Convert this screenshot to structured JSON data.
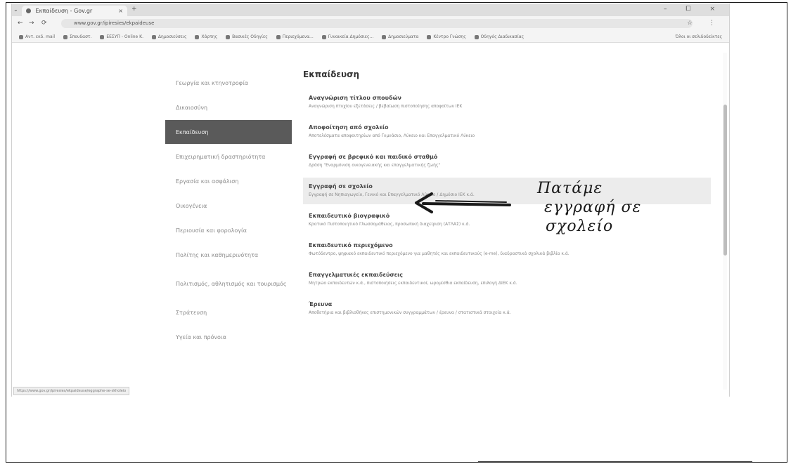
{
  "browser": {
    "tab_title": "Εκπαίδευση - Gov.gr",
    "tab_close": "×",
    "new_tab": "+",
    "window_controls": "– ⧠ ×",
    "tab_menu": "⌄",
    "back": "←",
    "forward": "→",
    "reload": "⟳",
    "address": "www.gov.gr/ipiresies/ekpaideuse",
    "toolbar_right": "☆ ⋮",
    "bookmarks": [
      "Αντ. εκδ. mail",
      "Σπουδαστ.",
      "ΕΕΣΥΠ - Online Κ.",
      "Δημοσιεύσεις",
      "Χάρτης",
      "Βασικές Οδηγίες",
      "Περιεχόμενα...",
      "Γυναικεία Δημόσιες...",
      "Δημοσιεύματα",
      "Κέντρο Γνώσης",
      "Οδηγός Διαδικασίας"
    ],
    "bookmarks_right": "Όλοι οι σελιδοδείκτες",
    "status_url": "https://www.gov.gr/ipiresies/ekpaideuse/eggraphe-se-skholeio"
  },
  "sidebar": {
    "items": [
      {
        "label": "Γεωργία και κτηνοτροφία"
      },
      {
        "label": "Δικαιοσύνη"
      },
      {
        "label": "Εκπαίδευση"
      },
      {
        "label": "Επιχειρηματική δραστηριότητα"
      },
      {
        "label": "Εργασία και ασφάλιση"
      },
      {
        "label": "Οικογένεια"
      },
      {
        "label": "Περιουσία και φορολογία"
      },
      {
        "label": "Πολίτης και καθημερινότητα"
      },
      {
        "label": "Πολιτισμός, αθλητισμός και τουρισμός"
      },
      {
        "label": "Στράτευση"
      },
      {
        "label": "Υγεία και πρόνοια"
      }
    ]
  },
  "main": {
    "title": "Εκπαίδευση",
    "entries": [
      {
        "title": "Αναγνώριση τίτλου σπουδών",
        "desc": "Αναγνώριση πτυχίου εξετάσεις / βεβαίωση πιστοποίησης αποφοίτων ΙΕΚ"
      },
      {
        "title": "Αποφοίτηση από σχολείο",
        "desc": "Αποτελέσματα αποφοιτηρίων από Γυμνάσιο, Λύκειο και Επαγγελματικό Λύκειο"
      },
      {
        "title": "Εγγραφή σε βρεφικό και παιδικό σταθμό",
        "desc": "Δράση \"Εναρμόνιση οικογενειακής και επαγγελματικής ζωής\""
      },
      {
        "title": "Εγγραφή σε σχολείο",
        "desc": "Εγγραφή σε Νηπιαγωγείο, Γενικό και Επαγγελματικό Λύκειο / Δημόσιο ΙΕΚ κ.ά."
      },
      {
        "title": "Εκπαιδευτικό βιογραφικό",
        "desc": "Κρατικό Πιστοποιητικό Γλωσσομάθειας, προσωπική διαχείριση (ΑΤΛΑΣ) κ.ά."
      },
      {
        "title": "Εκπαιδευτικό περιεχόμενο",
        "desc": "Φωτόδεντρο, ψηφιακό εκπαιδευτικό περιεχόμενο για μαθητές και εκπαιδευτικούς (e-me), διαδραστικά σχολικά βιβλία κ.ά."
      },
      {
        "title": "Επαγγελματικές εκπαιδεύσεις",
        "desc": "Μητρώο εκπαιδευτών κ.ά., πιστοποιήσεις εκπαιδευτικοί, ωρομίσθια εκπαίδευση, επιλογή ΔΙΕΚ κ.ά."
      },
      {
        "title": "Έρευνα",
        "desc": "Αποθετήρια και βιβλιοθήκες επιστημονικών συγγραμμάτων / έρευνα / στατιστικά στοιχεία κ.ά."
      }
    ]
  },
  "accessibility_icon": "accessibility-icon",
  "annotation": {
    "line1": "Πατάμε",
    "line2": "εγγραφή σε",
    "line3": "σχολείο"
  },
  "colors": {
    "active_item_bg": "#5a5a5a",
    "highlight_bg": "#ececec"
  }
}
